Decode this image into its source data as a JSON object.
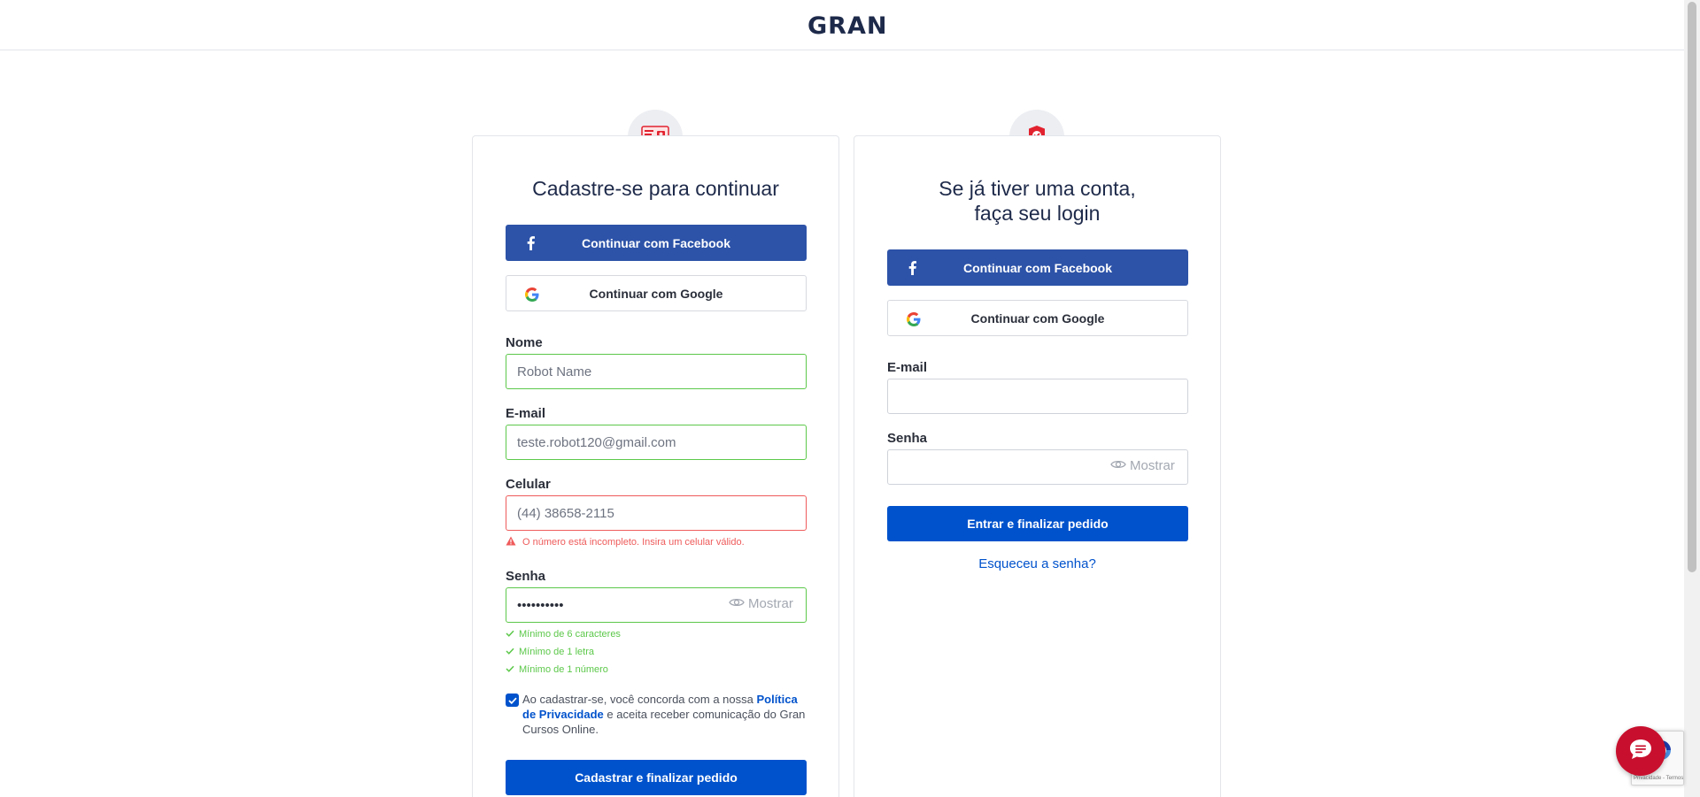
{
  "header": {
    "logo_text": "GRAN"
  },
  "signup": {
    "title": "Cadastre-se para continuar",
    "facebook_label": "Continuar com Facebook",
    "google_label": "Continuar com Google",
    "name_label": "Nome",
    "name_value": "Robot Name",
    "email_label": "E-mail",
    "email_value": "teste.robot120@gmail.com",
    "phone_label": "Celular",
    "phone_value": "(44) 38658-2115",
    "phone_error": "O número está incompleto. Insira um celular válido.",
    "password_label": "Senha",
    "password_value": "••••••••••",
    "show_label": "Mostrar",
    "rules": [
      "Mínimo de 6 caracteres",
      "Mínimo de 1 letra",
      "Mínimo de 1 número"
    ],
    "terms_before": "Ao cadastrar-se, você concorda com a nossa ",
    "terms_link": "Política de Privacidade",
    "terms_after": " e aceita receber comunicação do Gran Cursos Online.",
    "submit_label": "Cadastrar e finalizar pedido"
  },
  "login": {
    "title_line1": "Se já tiver uma conta,",
    "title_line2": "faça seu login",
    "facebook_label": "Continuar com Facebook",
    "google_label": "Continuar com Google",
    "email_label": "E-mail",
    "email_value": "",
    "password_label": "Senha",
    "show_label": "Mostrar",
    "submit_label": "Entrar e finalizar pedido",
    "forgot_label": "Esqueceu a senha?"
  },
  "recaptcha": {
    "text": "Privacidade - Termos"
  },
  "colors": {
    "primary": "#0052cc",
    "facebook": "#2d53a8",
    "success": "#5cc84a",
    "error": "#ef5b5b",
    "brand_red": "#e2222f"
  },
  "icons": {
    "signup_badge": "id-card-icon",
    "login_badge": "shield-check-icon",
    "facebook": "facebook-icon",
    "google": "google-icon",
    "eye": "eye-icon",
    "warning": "warning-icon",
    "check": "check-icon",
    "chat": "chat-icon"
  }
}
